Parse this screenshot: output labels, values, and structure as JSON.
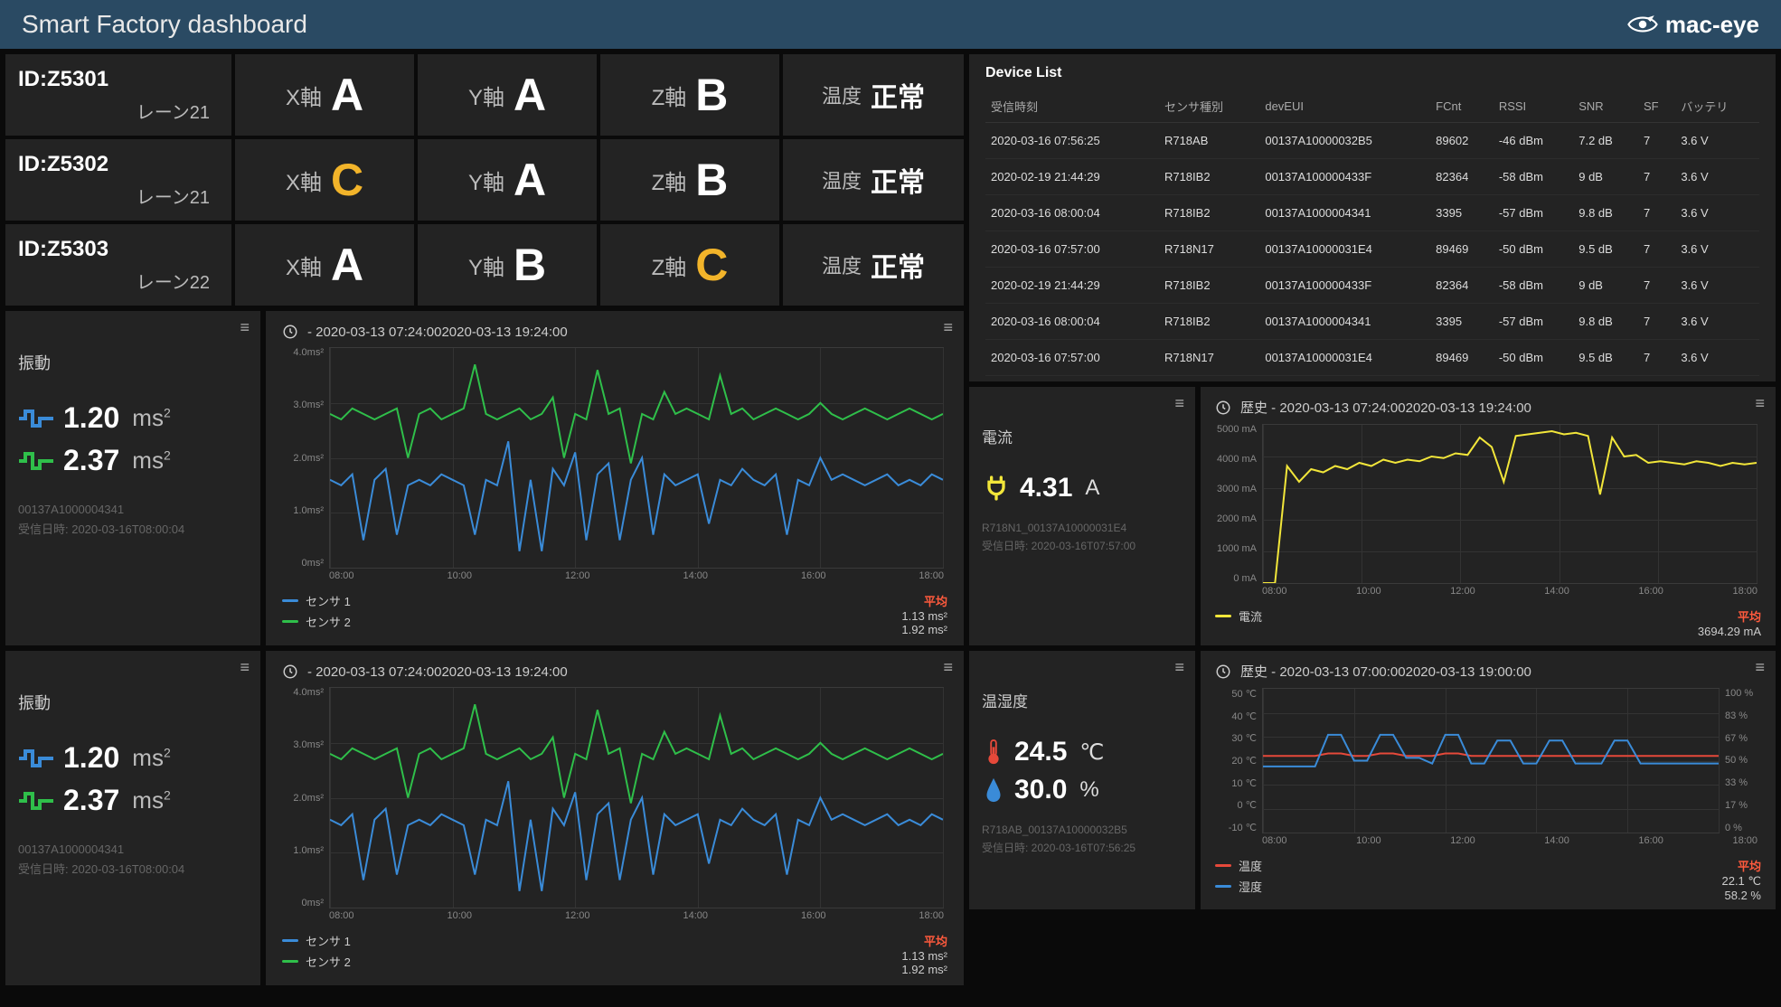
{
  "header": {
    "title": "Smart Factory dashboard",
    "brand": "mac-eye"
  },
  "lanes": [
    {
      "id": "ID:Z5301",
      "lane": "レーン21",
      "axes": [
        {
          "label": "X軸",
          "grade": "A"
        },
        {
          "label": "Y軸",
          "grade": "A"
        },
        {
          "label": "Z軸",
          "grade": "B"
        }
      ],
      "temp_label": "温度",
      "temp_status": "正常"
    },
    {
      "id": "ID:Z5302",
      "lane": "レーン21",
      "axes": [
        {
          "label": "X軸",
          "grade": "C"
        },
        {
          "label": "Y軸",
          "grade": "A"
        },
        {
          "label": "Z軸",
          "grade": "B"
        }
      ],
      "temp_label": "温度",
      "temp_status": "正常"
    },
    {
      "id": "ID:Z5303",
      "lane": "レーン22",
      "axes": [
        {
          "label": "X軸",
          "grade": "A"
        },
        {
          "label": "Y軸",
          "grade": "B"
        },
        {
          "label": "Z軸",
          "grade": "C"
        }
      ],
      "temp_label": "温度",
      "temp_status": "正常"
    }
  ],
  "vibration": [
    {
      "title": "振動",
      "metrics": [
        {
          "value": "1.20",
          "unit": "ms²",
          "color": "#3a8bd8"
        },
        {
          "value": "2.37",
          "unit": "ms²",
          "color": "#2fbf4a"
        }
      ],
      "dev": "00137A1000004341",
      "recv": "受信日時: 2020-03-16T08:00:04"
    },
    {
      "title": "振動",
      "metrics": [
        {
          "value": "1.20",
          "unit": "ms²",
          "color": "#3a8bd8"
        },
        {
          "value": "2.37",
          "unit": "ms²",
          "color": "#2fbf4a"
        }
      ],
      "dev": "00137A1000004341",
      "recv": "受信日時: 2020-03-16T08:00:04"
    }
  ],
  "vib_chart": {
    "title": " - 2020-03-13 07:24:002020-03-13 19:24:00",
    "legend": [
      {
        "name": "センサ 1",
        "color": "#3a8bd8",
        "avg": "1.13 ms²"
      },
      {
        "name": "センサ 2",
        "color": "#2fbf4a",
        "avg": "1.92 ms²"
      }
    ],
    "avg_label": "平均",
    "y_ticks": [
      "4.0ms²",
      "3.0ms²",
      "2.0ms²",
      "1.0ms²",
      "0ms²"
    ],
    "x_ticks": [
      "08:00",
      "10:00",
      "12:00",
      "14:00",
      "16:00",
      "18:00"
    ]
  },
  "device_list": {
    "title": "Device List",
    "columns": [
      "受信時刻",
      "センサ種別",
      "devEUI",
      "FCnt",
      "RSSI",
      "SNR",
      "SF",
      "バッテリ"
    ],
    "rows": [
      [
        "2020-03-16 07:56:25",
        "R718AB",
        "00137A10000032B5",
        "89602",
        "-46 dBm",
        "7.2 dB",
        "7",
        "3.6 V"
      ],
      [
        "2020-02-19 21:44:29",
        "R718IB2",
        "00137A100000433F",
        "82364",
        "-58 dBm",
        "9 dB",
        "7",
        "3.6 V"
      ],
      [
        "2020-03-16 08:00:04",
        "R718IB2",
        "00137A1000004341",
        "3395",
        "-57 dBm",
        "9.8 dB",
        "7",
        "3.6 V"
      ],
      [
        "2020-03-16 07:57:00",
        "R718N17",
        "00137A10000031E4",
        "89469",
        "-50 dBm",
        "9.5 dB",
        "7",
        "3.6 V"
      ],
      [
        "2020-02-19 21:44:29",
        "R718IB2",
        "00137A100000433F",
        "82364",
        "-58 dBm",
        "9 dB",
        "7",
        "3.6 V"
      ],
      [
        "2020-03-16 08:00:04",
        "R718IB2",
        "00137A1000004341",
        "3395",
        "-57 dBm",
        "9.8 dB",
        "7",
        "3.6 V"
      ],
      [
        "2020-03-16 07:57:00",
        "R718N17",
        "00137A10000031E4",
        "89469",
        "-50 dBm",
        "9.5 dB",
        "7",
        "3.6 V"
      ]
    ]
  },
  "current_panel": {
    "title": "電流",
    "value": "4.31",
    "unit": "A",
    "dev": "R718N1_00137A10000031E4",
    "recv": "受信日時: 2020-03-16T07:57:00"
  },
  "current_chart": {
    "title": "歴史 - 2020-03-13 07:24:002020-03-13 19:24:00",
    "legend": [
      {
        "name": "電流",
        "color": "#f2e63a",
        "avg": "3694.29 mA"
      }
    ],
    "avg_label": "平均",
    "y_ticks": [
      "5000 mA",
      "4000 mA",
      "3000 mA",
      "2000 mA",
      "1000 mA",
      "0 mA"
    ],
    "x_ticks": [
      "08:00",
      "10:00",
      "12:00",
      "14:00",
      "16:00",
      "18:00"
    ]
  },
  "temphum_panel": {
    "title": "温湿度",
    "temp_value": "24.5",
    "temp_unit": "℃",
    "hum_value": "30.0",
    "hum_unit": "%",
    "dev": "R718AB_00137A10000032B5",
    "recv": "受信日時: 2020-03-16T07:56:25"
  },
  "temphum_chart": {
    "title": "歴史 - 2020-03-13 07:00:002020-03-13 19:00:00",
    "legend": [
      {
        "name": "温度",
        "color": "#e6493a",
        "avg": "22.1 ℃"
      },
      {
        "name": "湿度",
        "color": "#3a8bd8",
        "avg": "58.2 %"
      }
    ],
    "avg_label": "平均",
    "y_ticks_left": [
      "50 ℃",
      "40 ℃",
      "30 ℃",
      "20 ℃",
      "10 ℃",
      "0 ℃",
      "-10 ℃"
    ],
    "y_ticks_right": [
      "100 %",
      "83 %",
      "67 %",
      "50 %",
      "33 %",
      "17 %",
      "0 %"
    ],
    "x_ticks": [
      "08:00",
      "10:00",
      "12:00",
      "14:00",
      "16:00",
      "18:00"
    ]
  },
  "colors": {
    "blue": "#3a8bd8",
    "green": "#2fbf4a",
    "yellow": "#f2e63a",
    "red": "#e6493a",
    "orange": "#f2b42a"
  },
  "chart_data": [
    {
      "id": "vibration-1",
      "type": "line",
      "title": " - 2020-03-13 07:24:002020-03-13 19:24:00",
      "xlabel": "time",
      "ylabel": "ms²",
      "ylim": [
        0,
        4
      ],
      "x_ticks": [
        "08:00",
        "10:00",
        "12:00",
        "14:00",
        "16:00",
        "18:00"
      ],
      "series": [
        {
          "name": "センサ 1",
          "color": "#3a8bd8",
          "avg": 1.13,
          "values": [
            1.6,
            1.5,
            1.7,
            0.5,
            1.6,
            1.8,
            0.6,
            1.5,
            1.6,
            1.5,
            1.7,
            1.6,
            1.5,
            0.6,
            1.6,
            1.5,
            2.3,
            0.3,
            1.6,
            0.3,
            1.8,
            1.5,
            2.1,
            0.5,
            1.7,
            1.9,
            0.5,
            1.6,
            2.0,
            0.6,
            1.7,
            1.5,
            1.6,
            1.7,
            0.8,
            1.6,
            1.5,
            1.8,
            1.6,
            1.5,
            1.7,
            0.6,
            1.6,
            1.5,
            2.0,
            1.6,
            1.7,
            1.6,
            1.5,
            1.6,
            1.7,
            1.5,
            1.6,
            1.5,
            1.7,
            1.6
          ]
        },
        {
          "name": "センサ 2",
          "color": "#2fbf4a",
          "avg": 1.92,
          "values": [
            2.8,
            2.7,
            2.9,
            2.8,
            2.7,
            2.8,
            2.9,
            2.0,
            2.8,
            2.9,
            2.7,
            2.8,
            2.9,
            3.7,
            2.8,
            2.7,
            2.8,
            2.9,
            2.7,
            2.8,
            3.1,
            2.0,
            2.8,
            2.7,
            3.6,
            2.8,
            2.9,
            1.9,
            2.8,
            2.7,
            3.2,
            2.8,
            2.9,
            2.8,
            2.7,
            3.5,
            2.8,
            2.9,
            2.7,
            2.8,
            2.9,
            2.8,
            2.7,
            2.8,
            3.0,
            2.8,
            2.7,
            2.8,
            2.9,
            2.8,
            2.7,
            2.8,
            2.9,
            2.8,
            2.7,
            2.8
          ]
        }
      ]
    },
    {
      "id": "vibration-2",
      "type": "line",
      "title": " - 2020-03-13 07:24:002020-03-13 19:24:00",
      "xlabel": "time",
      "ylabel": "ms²",
      "ylim": [
        0,
        4
      ],
      "x_ticks": [
        "08:00",
        "10:00",
        "12:00",
        "14:00",
        "16:00",
        "18:00"
      ],
      "series": [
        {
          "name": "センサ 1",
          "color": "#3a8bd8",
          "avg": 1.13,
          "values": [
            1.6,
            1.5,
            1.7,
            0.5,
            1.6,
            1.8,
            0.6,
            1.5,
            1.6,
            1.5,
            1.7,
            1.6,
            1.5,
            0.6,
            1.6,
            1.5,
            2.3,
            0.3,
            1.6,
            0.3,
            1.8,
            1.5,
            2.1,
            0.5,
            1.7,
            1.9,
            0.5,
            1.6,
            2.0,
            0.6,
            1.7,
            1.5,
            1.6,
            1.7,
            0.8,
            1.6,
            1.5,
            1.8,
            1.6,
            1.5,
            1.7,
            0.6,
            1.6,
            1.5,
            2.0,
            1.6,
            1.7,
            1.6,
            1.5,
            1.6,
            1.7,
            1.5,
            1.6,
            1.5,
            1.7,
            1.6
          ]
        },
        {
          "name": "センサ 2",
          "color": "#2fbf4a",
          "avg": 1.92,
          "values": [
            2.8,
            2.7,
            2.9,
            2.8,
            2.7,
            2.8,
            2.9,
            2.0,
            2.8,
            2.9,
            2.7,
            2.8,
            2.9,
            3.7,
            2.8,
            2.7,
            2.8,
            2.9,
            2.7,
            2.8,
            3.1,
            2.0,
            2.8,
            2.7,
            3.6,
            2.8,
            2.9,
            1.9,
            2.8,
            2.7,
            3.2,
            2.8,
            2.9,
            2.8,
            2.7,
            3.5,
            2.8,
            2.9,
            2.7,
            2.8,
            2.9,
            2.8,
            2.7,
            2.8,
            3.0,
            2.8,
            2.7,
            2.8,
            2.9,
            2.8,
            2.7,
            2.8,
            2.9,
            2.8,
            2.7,
            2.8
          ]
        }
      ]
    },
    {
      "id": "current",
      "type": "line",
      "title": "歴史 - 2020-03-13 07:24:002020-03-13 19:24:00",
      "xlabel": "time",
      "ylabel": "mA",
      "ylim": [
        0,
        5000
      ],
      "x_ticks": [
        "08:00",
        "10:00",
        "12:00",
        "14:00",
        "16:00",
        "18:00"
      ],
      "series": [
        {
          "name": "電流",
          "color": "#f2e63a",
          "avg": 3694.29,
          "values": [
            0,
            0,
            3700,
            3200,
            3600,
            3500,
            3700,
            3600,
            3800,
            3700,
            3900,
            3800,
            3900,
            3850,
            4000,
            3950,
            4100,
            4050,
            4600,
            4300,
            3200,
            4650,
            4700,
            4750,
            4800,
            4700,
            4750,
            4650,
            2800,
            4600,
            4000,
            4050,
            3800,
            3850,
            3800,
            3750,
            3850,
            3800,
            3700,
            3800,
            3750,
            3800
          ]
        }
      ]
    },
    {
      "id": "temp-humidity",
      "type": "line",
      "title": "歴史 - 2020-03-13 07:00:002020-03-13 19:00:00",
      "xlabel": "time",
      "x_ticks": [
        "08:00",
        "10:00",
        "12:00",
        "14:00",
        "16:00",
        "18:00"
      ],
      "y_axes": [
        {
          "label": "℃",
          "lim": [
            -10,
            50
          ]
        },
        {
          "label": "%",
          "lim": [
            0,
            100
          ]
        }
      ],
      "series": [
        {
          "name": "温度",
          "color": "#e6493a",
          "axis": 0,
          "avg": 22.1,
          "values": [
            22,
            22,
            22,
            22,
            22,
            23,
            23,
            22,
            22,
            23,
            23,
            22,
            22,
            22,
            23,
            23,
            22,
            22,
            22,
            22,
            22,
            22,
            22,
            22,
            22,
            22,
            22,
            22,
            22,
            22,
            22,
            22,
            22,
            22,
            22,
            22
          ]
        },
        {
          "name": "湿度",
          "color": "#3a8bd8",
          "axis": 1,
          "avg": 58.2,
          "values": [
            46,
            46,
            46,
            46,
            46,
            68,
            68,
            50,
            50,
            68,
            68,
            52,
            52,
            48,
            68,
            68,
            48,
            48,
            64,
            64,
            48,
            48,
            64,
            64,
            48,
            48,
            48,
            64,
            64,
            48,
            48,
            48,
            48,
            48,
            48,
            48
          ]
        }
      ]
    }
  ]
}
